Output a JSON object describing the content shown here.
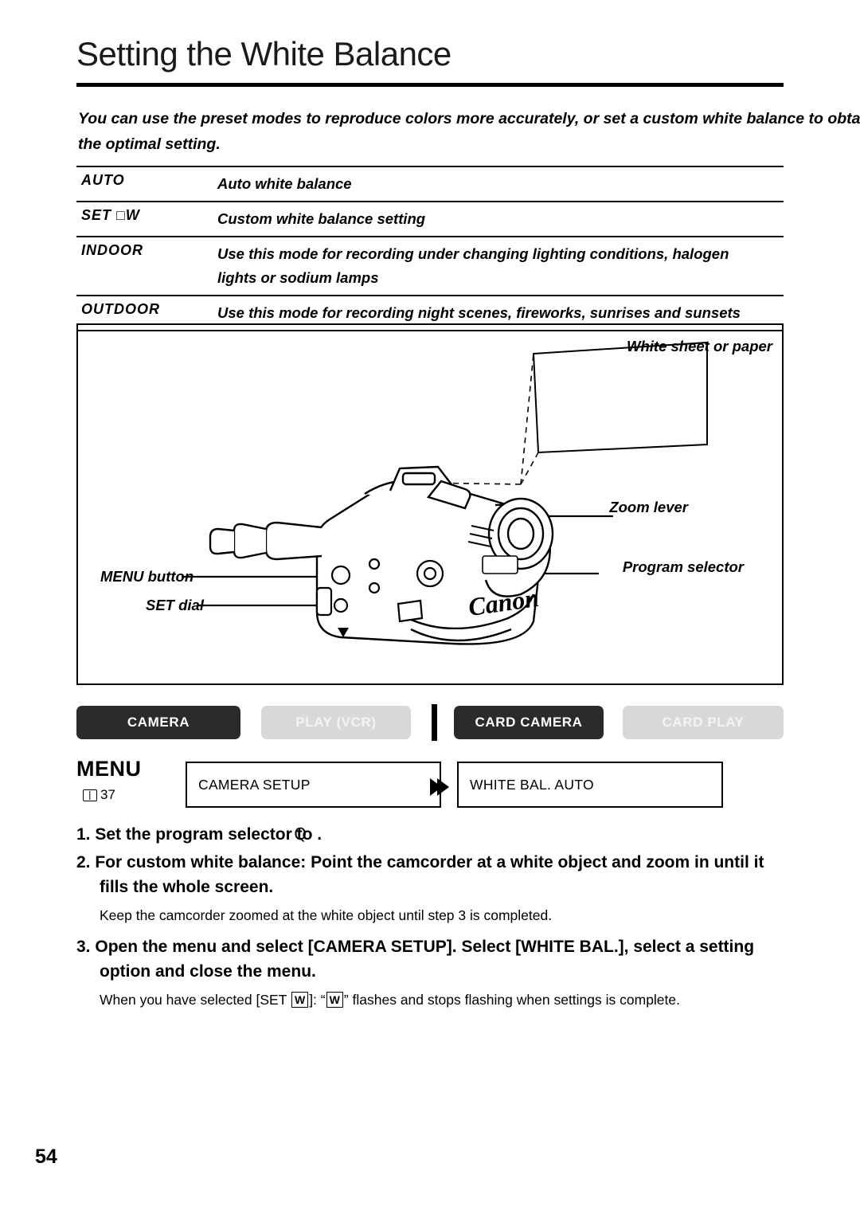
{
  "page": {
    "title": "Setting the White Balance",
    "number": "54",
    "intro": "You can use the preset modes to reproduce colors more accurately, or set a custom white balance to obtain the optimal setting."
  },
  "options": [
    {
      "key": "AUTO",
      "desc": "Auto white balance"
    },
    {
      "key": "SET □W",
      "desc": "Custom white balance setting"
    },
    {
      "key": "INDOOR",
      "desc": "Use this mode for recording under changing lighting conditions, halogen\nlights or sodium lamps"
    },
    {
      "key": "OUTDOOR",
      "desc": "Use this mode for recording night scenes, fireworks, sunrises and sunsets"
    }
  ],
  "illustration": {
    "labels": {
      "sheet": "White sheet or paper",
      "zoom": "Zoom lever",
      "program": "Program selector",
      "menu_button": "MENU button",
      "set_dial": "SET dial"
    },
    "brand": "Canon"
  },
  "modes": [
    {
      "label": "CAMERA",
      "state": "on"
    },
    {
      "label": "PLAY (VCR)",
      "state": "off"
    },
    {
      "label": "CARD CAMERA",
      "state": "on"
    },
    {
      "label": "CARD PLAY",
      "state": "off"
    }
  ],
  "menu": {
    "word": "MENU",
    "reference": "37",
    "path1": "CAMERA SETUP",
    "path2": "WHITE BAL.  AUTO"
  },
  "steps": [
    {
      "number": "1.",
      "head": "Set the program selector to",
      "head_tail": ".",
      "symbol": "Q",
      "sub": ""
    },
    {
      "number": "2.",
      "head": "For custom white balance: Point the camcorder at a white object and zoom in until it fills the whole screen.",
      "sub": "Keep the camcorder zoomed at the white object until step 3 is completed."
    },
    {
      "number": "3.",
      "head": "Open the menu and select [CAMERA SETUP]. Select [WHITE BAL.], select a setting option and close the menu.",
      "sub_pre": "When you have selected [SET",
      "sub_box1": "W",
      "sub_mid": "]: “",
      "sub_box2": "W",
      "sub_post": "” flashes and stops flashing when settings is complete."
    }
  ]
}
